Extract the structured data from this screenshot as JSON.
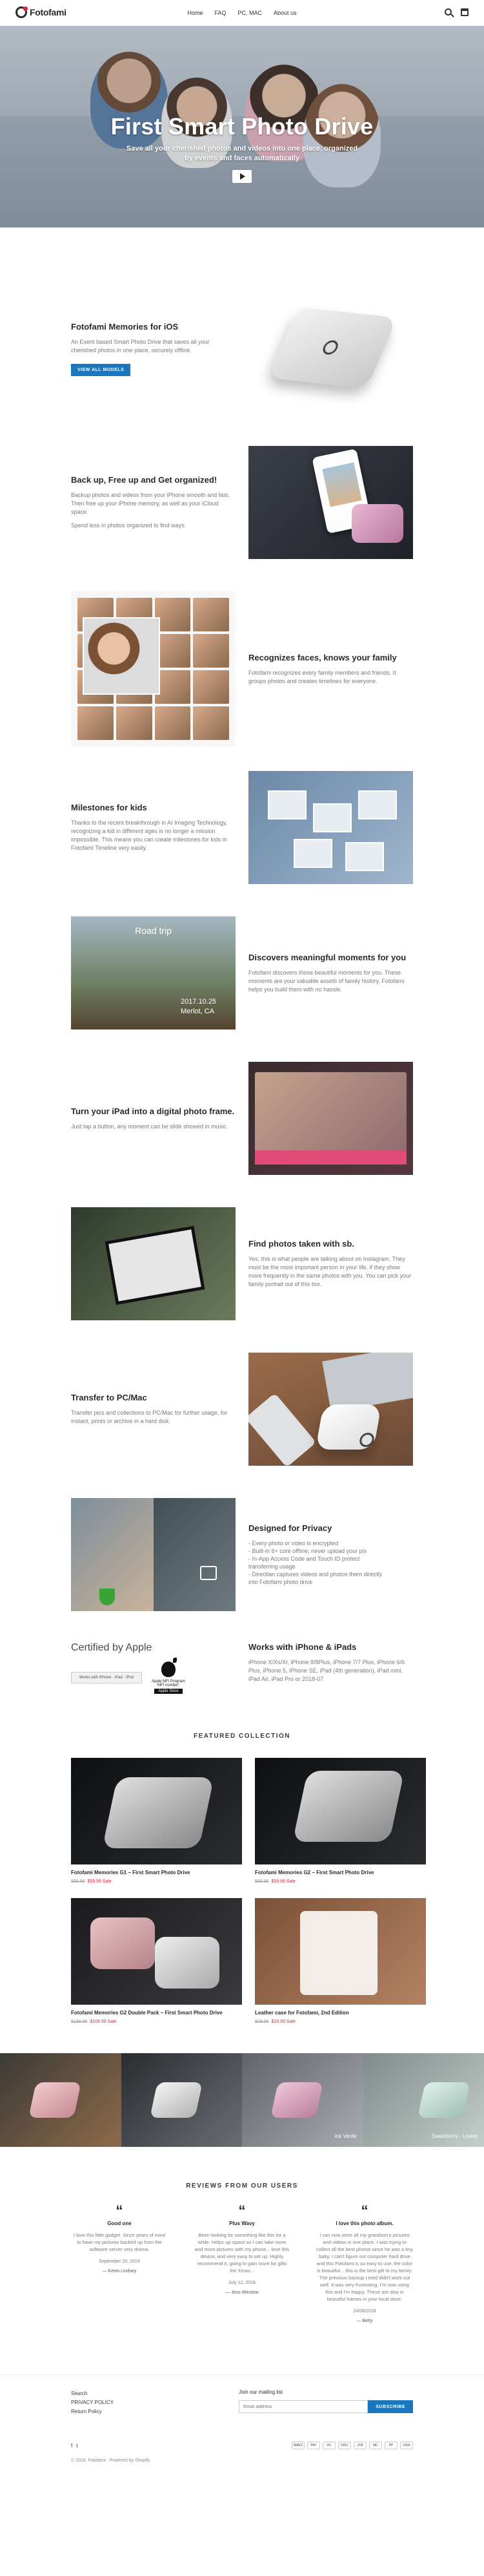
{
  "header": {
    "logo_text": "Fotofami",
    "nav": [
      "Home",
      "FAQ",
      "PC, MAC",
      "About us"
    ]
  },
  "hero": {
    "title": "First Smart Photo Drive",
    "subtitle_line1": "Save all your cherished photos and videos into one place, organized",
    "subtitle_line2": "by events and faces automatically"
  },
  "features": {
    "ios": {
      "title": "Fotofami Memories for iOS",
      "body": "An Event based Smart Photo Drive that saves all your cherished photos in one place, securely offline.",
      "button": "VIEW ALL MODELS"
    },
    "backup": {
      "title": "Back up, Free up and Get organized!",
      "body1": "Backup photos and videos from your iPhone smooth and fast. Then free up your iPhone memory, as well as your iCloud space.",
      "body2": "Spend less in photos organized to find ways."
    },
    "faces": {
      "title": "Recognizes faces, knows your family",
      "body": "Fotofami recognizes every family members and friends. It groups photos and creates timelines for everyone."
    },
    "milestones": {
      "title": "Milestones for kids",
      "body": "Thanks to the recent breakthrough in AI Imaging Technology, recognizing a kid in different ages is no longer a mission impossible. This means you can create milestones for kids in Fotofami Timeline very easily."
    },
    "moments": {
      "title": "Discovers meaningful moments for you",
      "body": "Fotofami discovers those beautiful moments for you. These moments are your valuable assets of family history. Fotofami helps you build them with no hassle.",
      "visual_label": "Road trip",
      "visual_date": "2017.10.25",
      "visual_place": "Merlot, CA"
    },
    "ipad": {
      "title": "Turn your iPad into a digital photo frame.",
      "body": "Just tap a button, any moment can be slide showed in music."
    },
    "find": {
      "title": "Find photos taken with sb.",
      "body": "Yes, this is what people are talking about on Instagram. They must be the most important person in your life, if they show more frequently in the same photos with you. You can pick your family portrait out of this too."
    },
    "pc": {
      "title": "Transfer to PC/Mac",
      "body": "Transfer pics and collections to PC/Mac for further usage, for instant, prints or archive in a hard disk."
    },
    "privacy": {
      "title": "Designed for Privacy",
      "items": [
        "- Every photo or video is encrypted",
        "- Built-in 6+ core offline, never upload your pix",
        "- In-App Access Code and Touch ID protect",
        "  transferring usage",
        "- Directlan captures videos and photos them directly",
        "  into Fotofami photo drive"
      ]
    }
  },
  "apple": {
    "certified": "Certified by Apple",
    "badge_text": "Works with iPhone · iPad · iPod",
    "mfi_line1": "Apple MFi Program",
    "mfi_line2": "MFI number:",
    "mfi_store": "Apple Store",
    "works_title": "Works with iPhone & iPads",
    "works_body": "iPhone X/Xs/Xr, iPhone 8/8Plus, iPhone 7/7 Plus, iPhone 6/6 Plus, iPhone 5, iPhone SE, iPad (4th generation), iPad mini, iPad Air, iPad Pro or 2018-07"
  },
  "featured": {
    "title": "FEATURED COLLECTION",
    "products": [
      {
        "name": "Fotofami Memories G1 – First Smart Photo Drive",
        "old": "$99.99",
        "new": "$59.99 Sale"
      },
      {
        "name": "Fotofami Memories G2 – First Smart Photo Drive",
        "old": "$99.99",
        "new": "$59.99 Sale"
      },
      {
        "name": "Fotofami Memories G2 Double Pack – First Smart Photo Drive",
        "old": "$199.99",
        "new": "$109.99 Sale"
      },
      {
        "name": "Leather case for Fotofami, 2nd Edition",
        "old": "$29.99",
        "new": "$19.99 Sale"
      }
    ]
  },
  "gallery": {
    "captions": [
      "",
      "",
      "Ice Verde",
      "Sweetberry · Lovely"
    ]
  },
  "reviews": {
    "title": "REVIEWS FROM OUR USERS",
    "items": [
      {
        "heading": "Good one",
        "body": "I love this little gadget. Since years of mind to have my pictures backed up from the software server very drama.",
        "date": "September 20, 2018",
        "author": "— Kevin Lindsey"
      },
      {
        "heading": "Plus Wavy",
        "body": "Been looking for something like this for a while. Helps up space so I can take more and more pictures with my phone... love this device, and very easy to set up. Highly recommend it, going to gain more for gifts the Xmas...",
        "date": "July 12, 2018",
        "author": "— Jess Winslow"
      },
      {
        "heading": "I love this photo album.",
        "body": "I can now store all my grandson's pictures and videos in one place. I was trying to collect all the best photos since he was a tiny baby. I can't figure out computer hard drive and this Fotofami is so easy to use, the color is beautiful... this is the best gift to my family. The previous backup I tried didn't work out well. It was very frustrating, I'm now using this and I'm happy. These are also in beautiful frames in your local store.",
        "date": "24/08/2018",
        "author": "— Betty"
      }
    ]
  },
  "footer": {
    "links": [
      "Search",
      "PRIVACY POLICY",
      "Return Policy"
    ],
    "newsletter_label": "Join our mailing list",
    "newsletter_placeholder": "Email address",
    "newsletter_button": "SUBSCRIBE",
    "copyright": "© 2018, Fotofami · Powered by Shopify",
    "payments": [
      "AMEX",
      "PAY",
      "DC",
      "DISC",
      "JCB",
      "MC",
      "PP",
      "VISA"
    ]
  }
}
